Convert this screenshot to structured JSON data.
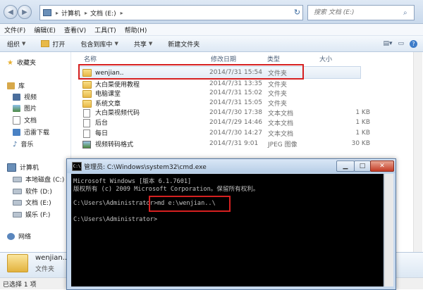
{
  "address": {
    "segments": [
      "计算机",
      "文档 (E:)"
    ],
    "search_placeholder": "搜索 文档 (E:)"
  },
  "menu": [
    "文件(F)",
    "编辑(E)",
    "查看(V)",
    "工具(T)",
    "帮助(H)"
  ],
  "toolbar": {
    "organize": "组织",
    "open": "打开",
    "include_in_library": "包含到库中",
    "share": "共享",
    "new_folder": "新建文件夹"
  },
  "nav": {
    "favorites": "收藏夹",
    "libraries": "库",
    "videos": "视频",
    "pictures": "图片",
    "documents": "文档",
    "downloads": "迅雷下载",
    "music": "音乐",
    "computer": "计算机",
    "drive_c": "本地磁盘 (C:)",
    "drive_d": "软件 (D:)",
    "drive_e": "文档 (E:)",
    "drive_f": "娱乐 (F:)",
    "network": "网络"
  },
  "columns": {
    "name": "名称",
    "date": "修改日期",
    "type": "类型",
    "size": "大小"
  },
  "files": [
    {
      "name": "wenjian..",
      "date": "2014/7/31 15:54",
      "type": "文件夹",
      "size": "",
      "icon": "folder-icon"
    },
    {
      "name": "大白菜使用教程",
      "date": "2014/7/31 13:35",
      "type": "文件夹",
      "size": "",
      "icon": "folder-icon"
    },
    {
      "name": "电脑课堂",
      "date": "2014/7/31 15:02",
      "type": "文件夹",
      "size": "",
      "icon": "folder-icon"
    },
    {
      "name": "系统文章",
      "date": "2014/7/31 15:05",
      "type": "文件夹",
      "size": "",
      "icon": "folder-icon"
    },
    {
      "name": "大白菜视频代码",
      "date": "2014/7/30 17:38",
      "type": "文本文档",
      "size": "1 KB",
      "icon": "text-file-icon"
    },
    {
      "name": "后台",
      "date": "2014/7/29 14:46",
      "type": "文本文档",
      "size": "1 KB",
      "icon": "text-file-icon"
    },
    {
      "name": "每日",
      "date": "2014/7/30 14:27",
      "type": "文本文档",
      "size": "1 KB",
      "icon": "text-file-icon"
    },
    {
      "name": "视频转码格式",
      "date": "2014/7/31 9:01",
      "type": "JPEG 图像",
      "size": "30 KB",
      "icon": "image-file-icon"
    }
  ],
  "details": {
    "name": "wenjian..",
    "type": "文件夹"
  },
  "status": "已选择 1 项",
  "cmd": {
    "title": "管理员: C:\\Windows\\system32\\cmd.exe",
    "icon_text": "C:\\",
    "lines": [
      "Microsoft Windows [版本 6.1.7601]",
      "版权所有 (c) 2009 Microsoft Corporation。保留所有权利。",
      "",
      "C:\\Users\\Administrator>md e:\\wenjian..\\",
      "",
      "C:\\Users\\Administrator>"
    ]
  },
  "colors": {
    "highlight_box": "#d62020",
    "console_bg": "#000000",
    "console_text": "#c0c0c0",
    "folder": "#e8b948"
  }
}
